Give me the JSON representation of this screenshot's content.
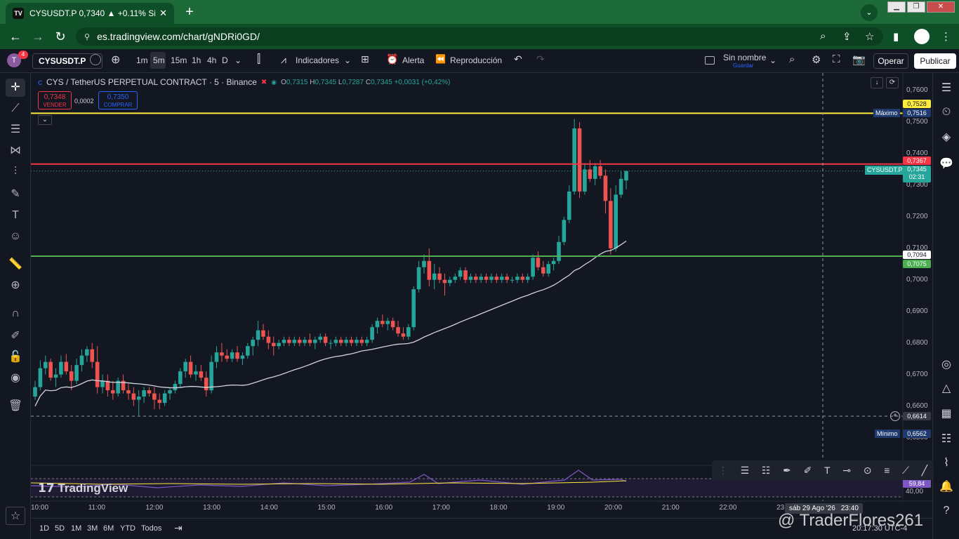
{
  "browser": {
    "tab_title": "CYSUSDT.P 0,7340 ▲ +0.11% Sin",
    "favicon_text": "TV",
    "url": "es.tradingview.com/chart/gNDRi0GD/",
    "new_tab": "+"
  },
  "toolbar": {
    "avatar_letter": "T",
    "notif_count": "4",
    "symbol": "CYSUSDT.P",
    "timeframes": [
      "1m",
      "5m",
      "15m",
      "1h",
      "4h",
      "D"
    ],
    "indicators_label": "Indicadores",
    "alert_label": "Alerta",
    "replay_label": "Reproducción",
    "layout_name": "Sin nombre",
    "layout_sub": "Guardar",
    "operar_label": "Operar",
    "publish_label": "Publicar"
  },
  "legend": {
    "title": "CYS / TetherUS PERPETUAL CONTRACT · 5 · Binance",
    "o_label": "O",
    "o": "0,7315",
    "h_label": "H",
    "h": "0,7345",
    "l_label": "L",
    "l": "0,7287",
    "c_label": "C",
    "c": "0,7345",
    "change": "+0,0031 (+0,42%)",
    "sell_price": "0,7348",
    "sell_label": "VENDER",
    "spread": "0,0002",
    "buy_price": "0,7350",
    "buy_label": "COMPRAR"
  },
  "price_scale": {
    "ticks": [
      "0,7600",
      "0,7500",
      "0,7400",
      "0,7300",
      "0,7200",
      "0,7100",
      "0,7000",
      "0,6900",
      "0,6800",
      "0,6700",
      "0,6600",
      "0,6500"
    ],
    "max_label": "Máximo",
    "max_value": "0,7516",
    "min_label": "Mínimo",
    "min_value": "0,6562",
    "yellow_line": "0,7528",
    "red_line": "0,7367",
    "last_symbol": "CYSUSDT.P",
    "last_price": "0,7345",
    "countdown": "02:31",
    "white_level": "0,7094",
    "green_line": "0,7075",
    "crosshair": "0,6614",
    "rsi_value": "59,84",
    "rsi_level": "40,00"
  },
  "time_scale": {
    "ticks": [
      "10:00",
      "11:00",
      "12:00",
      "13:00",
      "14:00",
      "15:00",
      "16:00",
      "17:00",
      "18:00",
      "19:00",
      "20:00",
      "21:00",
      "22:00",
      "23:",
      "01:0"
    ],
    "crosshair_date": "sáb 29 Ago '26",
    "crosshair_time": "23:40"
  },
  "bottom": {
    "ranges": [
      "1D",
      "5D",
      "1M",
      "3M",
      "6M",
      "YTD",
      "Todos"
    ],
    "clock": "20:17:30 UTC-4"
  },
  "branding": {
    "logo_text": "TradingView",
    "watermark": "@ TraderFlores261"
  },
  "chart_data": {
    "type": "candlestick",
    "symbol": "CYSUSDT.P",
    "interval": "5",
    "exchange": "Binance",
    "ylim": [
      0.645,
      0.762
    ],
    "horizontal_lines": [
      {
        "value": 0.7528,
        "color": "#ffeb3b"
      },
      {
        "value": 0.7367,
        "color": "#f23645"
      },
      {
        "value": 0.7075,
        "color": "#4caf50"
      }
    ],
    "colors": {
      "up": "#26a69a",
      "down": "#ef5350",
      "ma": "#d1d4dc"
    },
    "candles": [
      [
        0.663,
        0.668,
        0.662,
        0.666
      ],
      [
        0.666,
        0.6745,
        0.665,
        0.672
      ],
      [
        0.672,
        0.676,
        0.67,
        0.674
      ],
      [
        0.674,
        0.675,
        0.668,
        0.669
      ],
      [
        0.669,
        0.672,
        0.666,
        0.67
      ],
      [
        0.67,
        0.676,
        0.669,
        0.674
      ],
      [
        0.674,
        0.6765,
        0.67,
        0.671
      ],
      [
        0.671,
        0.673,
        0.665,
        0.668
      ],
      [
        0.668,
        0.675,
        0.667,
        0.673
      ],
      [
        0.673,
        0.678,
        0.671,
        0.676
      ],
      [
        0.676,
        0.679,
        0.674,
        0.678
      ],
      [
        0.678,
        0.68,
        0.672,
        0.674
      ],
      [
        0.674,
        0.679,
        0.664,
        0.666
      ],
      [
        0.666,
        0.67,
        0.664,
        0.668
      ],
      [
        0.668,
        0.67,
        0.663,
        0.665
      ],
      [
        0.665,
        0.668,
        0.662,
        0.664
      ],
      [
        0.664,
        0.669,
        0.663,
        0.668
      ],
      [
        0.668,
        0.67,
        0.664,
        0.665
      ],
      [
        0.665,
        0.667,
        0.662,
        0.664
      ],
      [
        0.664,
        0.666,
        0.66,
        0.662
      ],
      [
        0.662,
        0.665,
        0.657,
        0.663
      ],
      [
        0.663,
        0.666,
        0.661,
        0.665
      ],
      [
        0.665,
        0.666,
        0.663,
        0.664
      ],
      [
        0.664,
        0.666,
        0.659,
        0.662
      ],
      [
        0.662,
        0.664,
        0.659,
        0.661
      ],
      [
        0.661,
        0.665,
        0.66,
        0.664
      ],
      [
        0.664,
        0.666,
        0.662,
        0.665
      ],
      [
        0.665,
        0.668,
        0.664,
        0.667
      ],
      [
        0.667,
        0.672,
        0.666,
        0.671
      ],
      [
        0.671,
        0.675,
        0.669,
        0.674
      ],
      [
        0.674,
        0.676,
        0.669,
        0.67
      ],
      [
        0.67,
        0.673,
        0.668,
        0.671
      ],
      [
        0.671,
        0.673,
        0.668,
        0.669
      ],
      [
        0.669,
        0.671,
        0.663,
        0.665
      ],
      [
        0.665,
        0.676,
        0.664,
        0.674
      ],
      [
        0.674,
        0.679,
        0.672,
        0.677
      ],
      [
        0.677,
        0.68,
        0.674,
        0.676
      ],
      [
        0.676,
        0.678,
        0.674,
        0.675
      ],
      [
        0.675,
        0.678,
        0.674,
        0.677
      ],
      [
        0.677,
        0.679,
        0.674,
        0.675
      ],
      [
        0.675,
        0.677,
        0.673,
        0.676
      ],
      [
        0.676,
        0.68,
        0.675,
        0.679
      ],
      [
        0.679,
        0.682,
        0.676,
        0.681
      ],
      [
        0.681,
        0.687,
        0.679,
        0.684
      ],
      [
        0.684,
        0.686,
        0.681,
        0.682
      ],
      [
        0.682,
        0.684,
        0.678,
        0.68
      ],
      [
        0.68,
        0.682,
        0.676,
        0.679
      ],
      [
        0.679,
        0.681,
        0.678,
        0.68
      ],
      [
        0.68,
        0.682,
        0.679,
        0.681
      ],
      [
        0.681,
        0.682,
        0.679,
        0.68
      ],
      [
        0.68,
        0.682,
        0.679,
        0.681
      ],
      [
        0.681,
        0.682,
        0.679,
        0.68
      ],
      [
        0.68,
        0.682,
        0.679,
        0.681
      ],
      [
        0.681,
        0.683,
        0.679,
        0.68
      ],
      [
        0.68,
        0.682,
        0.678,
        0.681
      ],
      [
        0.681,
        0.683,
        0.68,
        0.682
      ],
      [
        0.682,
        0.683,
        0.679,
        0.68
      ],
      [
        0.68,
        0.681,
        0.678,
        0.68
      ],
      [
        0.68,
        0.682,
        0.679,
        0.681
      ],
      [
        0.681,
        0.682,
        0.679,
        0.68
      ],
      [
        0.68,
        0.682,
        0.679,
        0.681
      ],
      [
        0.681,
        0.682,
        0.679,
        0.68
      ],
      [
        0.68,
        0.682,
        0.679,
        0.681
      ],
      [
        0.681,
        0.682,
        0.679,
        0.68
      ],
      [
        0.68,
        0.682,
        0.679,
        0.681
      ],
      [
        0.681,
        0.686,
        0.68,
        0.685
      ],
      [
        0.685,
        0.688,
        0.683,
        0.687
      ],
      [
        0.687,
        0.689,
        0.685,
        0.686
      ],
      [
        0.686,
        0.688,
        0.684,
        0.687
      ],
      [
        0.687,
        0.688,
        0.684,
        0.685
      ],
      [
        0.685,
        0.687,
        0.682,
        0.683
      ],
      [
        0.683,
        0.685,
        0.681,
        0.682
      ],
      [
        0.682,
        0.686,
        0.681,
        0.685
      ],
      [
        0.685,
        0.698,
        0.684,
        0.697
      ],
      [
        0.697,
        0.706,
        0.696,
        0.704
      ],
      [
        0.704,
        0.708,
        0.702,
        0.706
      ],
      [
        0.706,
        0.71,
        0.698,
        0.7
      ],
      [
        0.7,
        0.705,
        0.697,
        0.702
      ],
      [
        0.702,
        0.704,
        0.699,
        0.7
      ],
      [
        0.7,
        0.702,
        0.695,
        0.699
      ],
      [
        0.699,
        0.701,
        0.698,
        0.7
      ],
      [
        0.7,
        0.702,
        0.699,
        0.701
      ],
      [
        0.701,
        0.704,
        0.7,
        0.703
      ],
      [
        0.703,
        0.704,
        0.699,
        0.7
      ],
      [
        0.7,
        0.702,
        0.699,
        0.701
      ],
      [
        0.701,
        0.702,
        0.699,
        0.7
      ],
      [
        0.7,
        0.702,
        0.699,
        0.701
      ],
      [
        0.701,
        0.702,
        0.699,
        0.7
      ],
      [
        0.7,
        0.702,
        0.699,
        0.701
      ],
      [
        0.701,
        0.702,
        0.699,
        0.7
      ],
      [
        0.7,
        0.702,
        0.699,
        0.701
      ],
      [
        0.701,
        0.702,
        0.699,
        0.7
      ],
      [
        0.7,
        0.701,
        0.699,
        0.7
      ],
      [
        0.7,
        0.702,
        0.699,
        0.701
      ],
      [
        0.701,
        0.702,
        0.699,
        0.7
      ],
      [
        0.7,
        0.702,
        0.699,
        0.701
      ],
      [
        0.701,
        0.708,
        0.7,
        0.707
      ],
      [
        0.707,
        0.709,
        0.703,
        0.704
      ],
      [
        0.704,
        0.706,
        0.701,
        0.702
      ],
      [
        0.702,
        0.706,
        0.701,
        0.705
      ],
      [
        0.705,
        0.707,
        0.703,
        0.706
      ],
      [
        0.706,
        0.714,
        0.705,
        0.712
      ],
      [
        0.712,
        0.72,
        0.711,
        0.719
      ],
      [
        0.719,
        0.73,
        0.718,
        0.728
      ],
      [
        0.728,
        0.751,
        0.727,
        0.748
      ],
      [
        0.748,
        0.75,
        0.726,
        0.728
      ],
      [
        0.728,
        0.737,
        0.727,
        0.735
      ],
      [
        0.735,
        0.738,
        0.731,
        0.732
      ],
      [
        0.732,
        0.737,
        0.73,
        0.736
      ],
      [
        0.736,
        0.738,
        0.732,
        0.733
      ],
      [
        0.733,
        0.735,
        0.721,
        0.725
      ],
      [
        0.725,
        0.729,
        0.708,
        0.71
      ],
      [
        0.71,
        0.73,
        0.709,
        0.727
      ],
      [
        0.727,
        0.7345,
        0.726,
        0.732
      ],
      [
        0.7315,
        0.7345,
        0.7287,
        0.7345
      ]
    ]
  }
}
